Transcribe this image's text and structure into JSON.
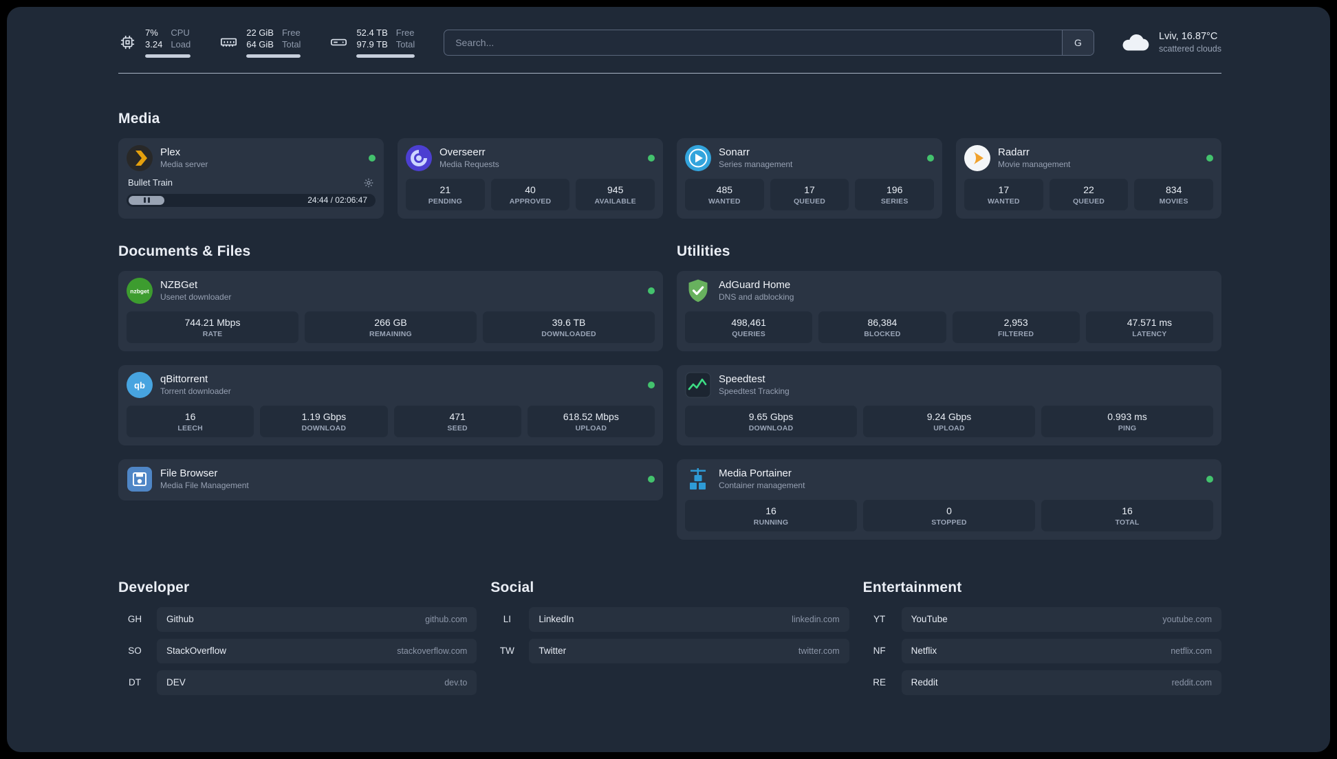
{
  "topbar": {
    "cpu": {
      "value_top": "7%",
      "value_bottom": "3.24",
      "label_top": "CPU",
      "label_bottom": "Load"
    },
    "memory": {
      "value_top": "22 GiB",
      "value_bottom": "64 GiB",
      "label_top": "Free",
      "label_bottom": "Total"
    },
    "storage": {
      "value_top": "52.4 TB",
      "value_bottom": "97.9 TB",
      "label_top": "Free",
      "label_bottom": "Total"
    },
    "search": {
      "placeholder": "Search...",
      "button_label": "G"
    },
    "weather": {
      "location": "Lviv, 16.87°C",
      "condition": "scattered clouds"
    }
  },
  "sections": {
    "media": "Media",
    "documents": "Documents & Files",
    "utilities": "Utilities",
    "developer": "Developer",
    "social": "Social",
    "entertainment": "Entertainment"
  },
  "apps": {
    "plex": {
      "name": "Plex",
      "subtitle": "Media server",
      "now_playing": "Bullet Train",
      "progress_time": "24:44 / 02:06:47"
    },
    "overseerr": {
      "name": "Overseerr",
      "subtitle": "Media Requests",
      "stats": [
        {
          "value": "21",
          "label": "PENDING"
        },
        {
          "value": "40",
          "label": "APPROVED"
        },
        {
          "value": "945",
          "label": "AVAILABLE"
        }
      ]
    },
    "sonarr": {
      "name": "Sonarr",
      "subtitle": "Series management",
      "stats": [
        {
          "value": "485",
          "label": "WANTED"
        },
        {
          "value": "17",
          "label": "QUEUED"
        },
        {
          "value": "196",
          "label": "SERIES"
        }
      ]
    },
    "radarr": {
      "name": "Radarr",
      "subtitle": "Movie management",
      "stats": [
        {
          "value": "17",
          "label": "WANTED"
        },
        {
          "value": "22",
          "label": "QUEUED"
        },
        {
          "value": "834",
          "label": "MOVIES"
        }
      ]
    },
    "nzbget": {
      "name": "NZBGet",
      "subtitle": "Usenet downloader",
      "icon_text": "nzbget",
      "stats": [
        {
          "value": "744.21 Mbps",
          "label": "RATE"
        },
        {
          "value": "266 GB",
          "label": "REMAINING"
        },
        {
          "value": "39.6 TB",
          "label": "DOWNLOADED"
        }
      ]
    },
    "qbittorrent": {
      "name": "qBittorrent",
      "subtitle": "Torrent downloader",
      "icon_text": "qb",
      "stats": [
        {
          "value": "16",
          "label": "LEECH"
        },
        {
          "value": "1.19 Gbps",
          "label": "DOWNLOAD"
        },
        {
          "value": "471",
          "label": "SEED"
        },
        {
          "value": "618.52 Mbps",
          "label": "UPLOAD"
        }
      ]
    },
    "filebrowser": {
      "name": "File Browser",
      "subtitle": "Media File Management"
    },
    "adguard": {
      "name": "AdGuard Home",
      "subtitle": "DNS and adblocking",
      "stats": [
        {
          "value": "498,461",
          "label": "QUERIES"
        },
        {
          "value": "86,384",
          "label": "BLOCKED"
        },
        {
          "value": "2,953",
          "label": "FILTERED"
        },
        {
          "value": "47.571 ms",
          "label": "LATENCY"
        }
      ]
    },
    "speedtest": {
      "name": "Speedtest",
      "subtitle": "Speedtest Tracking",
      "stats": [
        {
          "value": "9.65 Gbps",
          "label": "DOWNLOAD"
        },
        {
          "value": "9.24 Gbps",
          "label": "UPLOAD"
        },
        {
          "value": "0.993 ms",
          "label": "PING"
        }
      ]
    },
    "portainer": {
      "name": "Media Portainer",
      "subtitle": "Container management",
      "stats": [
        {
          "value": "16",
          "label": "RUNNING"
        },
        {
          "value": "0",
          "label": "STOPPED"
        },
        {
          "value": "16",
          "label": "TOTAL"
        }
      ]
    }
  },
  "bookmarks": {
    "developer": [
      {
        "abbr": "GH",
        "name": "Github",
        "url": "github.com"
      },
      {
        "abbr": "SO",
        "name": "StackOverflow",
        "url": "stackoverflow.com"
      },
      {
        "abbr": "DT",
        "name": "DEV",
        "url": "dev.to"
      }
    ],
    "social": [
      {
        "abbr": "LI",
        "name": "LinkedIn",
        "url": "linkedin.com"
      },
      {
        "abbr": "TW",
        "name": "Twitter",
        "url": "twitter.com"
      }
    ],
    "entertainment": [
      {
        "abbr": "YT",
        "name": "YouTube",
        "url": "youtube.com"
      },
      {
        "abbr": "NF",
        "name": "Netflix",
        "url": "netflix.com"
      },
      {
        "abbr": "RE",
        "name": "Reddit",
        "url": "reddit.com"
      }
    ]
  },
  "colors": {
    "status_online": "#43c26d",
    "plex": "#e5a00d",
    "overseerr": "#4c3fd1",
    "sonarr": "#33a4dc",
    "radarr": "#f0a12c",
    "nzbget": "#3d9c2f",
    "qbittorrent": "#47a4e0",
    "filebrowser": "#4f86c6",
    "adguard": "#68b15e",
    "speedtest_line": "#3ddc84",
    "portainer": "#2e9bd6"
  }
}
